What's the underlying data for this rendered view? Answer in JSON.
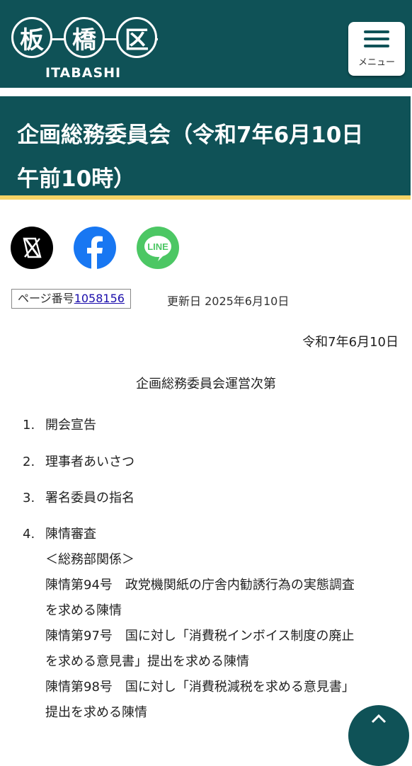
{
  "header": {
    "logo_kanji": [
      "板",
      "橋",
      "区"
    ],
    "logo_roman": "ITABASHI",
    "menu_label": "メニュー"
  },
  "title": "企画総務委員会（令和7年6月10日　午前10時）",
  "share": {
    "icons": [
      "x-icon",
      "facebook-icon",
      "line-icon"
    ],
    "line_text": "LINE",
    "colors": {
      "x": "#000000",
      "facebook": "#1877f2",
      "line": "#4cc764"
    }
  },
  "meta": {
    "page_no_label": "ページ番号",
    "page_no": "1058156",
    "updated": "更新日 2025年6月10日"
  },
  "document": {
    "date": "令和7年6月10日",
    "heading": "企画総務委員会運営次第",
    "items": [
      {
        "num": "1.",
        "text": "開会宣告"
      },
      {
        "num": "2.",
        "text": "理事者あいさつ"
      },
      {
        "num": "3.",
        "text": "署名委員の指名"
      },
      {
        "num": "4.",
        "text": "陳情審査"
      }
    ],
    "item4_lines": [
      "＜総務部関係＞",
      "陳情第94号　政党機関紙の庁舎内勧誘行為の実態調査",
      "を求める陳情",
      "陳情第97号　国に対し「消費税インボイス制度の廃止",
      "を求める意見書」提出を求める陳情",
      "陳情第98号　国に対し「消費税減税を求める意見書」",
      "提出を求める陳情"
    ]
  },
  "colors": {
    "brand": "#0f5257",
    "accent": "#f5d265",
    "link": "#1a0dab"
  }
}
